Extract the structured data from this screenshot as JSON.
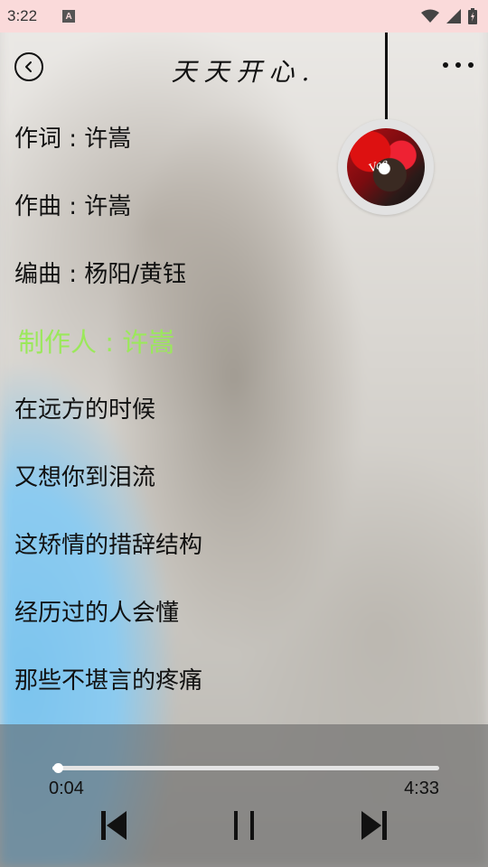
{
  "status_bar": {
    "time": "3:22",
    "notification_icon": "a-icon",
    "icons": [
      "wifi-icon",
      "signal-icon",
      "battery-icon"
    ]
  },
  "header": {
    "title": "天天开心.",
    "back_icon": "back-icon",
    "more_icon": "more-icon"
  },
  "album": {
    "cover_text": "Vae"
  },
  "lyrics": [
    {
      "text": "作词 : 许嵩",
      "active": false
    },
    {
      "text": "作曲 : 许嵩",
      "active": false
    },
    {
      "text": "编曲 : 杨阳/黄钰",
      "active": false
    },
    {
      "text": "制作人 : 许嵩",
      "active": true
    },
    {
      "text": "在远方的时候",
      "active": false
    },
    {
      "text": "又想你到泪流",
      "active": false
    },
    {
      "text": "这矫情的措辞结构",
      "active": false
    },
    {
      "text": "经历过的人会懂",
      "active": false
    },
    {
      "text": "那些不堪言的疼痛",
      "active": false
    }
  ],
  "player": {
    "current_time": "0:04",
    "total_time": "4:33",
    "progress": 0.015,
    "controls": [
      "previous-icon",
      "pause-icon",
      "next-icon"
    ]
  },
  "colors": {
    "active_lyric": "#9be85b",
    "status_bar_bg": "#fadada",
    "player_bg": "rgba(95,95,95,0.55)"
  }
}
